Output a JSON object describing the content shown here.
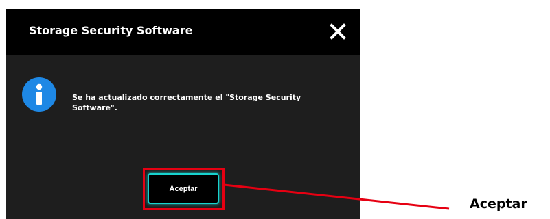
{
  "dialog": {
    "title": "Storage Security Software",
    "close_icon": "close-icon",
    "info_icon": "info-icon",
    "message": "Se ha actualizado correctamente el \"Storage Security Software\".",
    "accept_label": "Aceptar"
  },
  "annotation": {
    "label": "Aceptar",
    "highlight_color": "#e60012"
  },
  "colors": {
    "titlebar": "#000000",
    "dialog_body": "#1e1e1e",
    "info_icon": "#1e88e5",
    "button_border": "#17d3cf"
  }
}
